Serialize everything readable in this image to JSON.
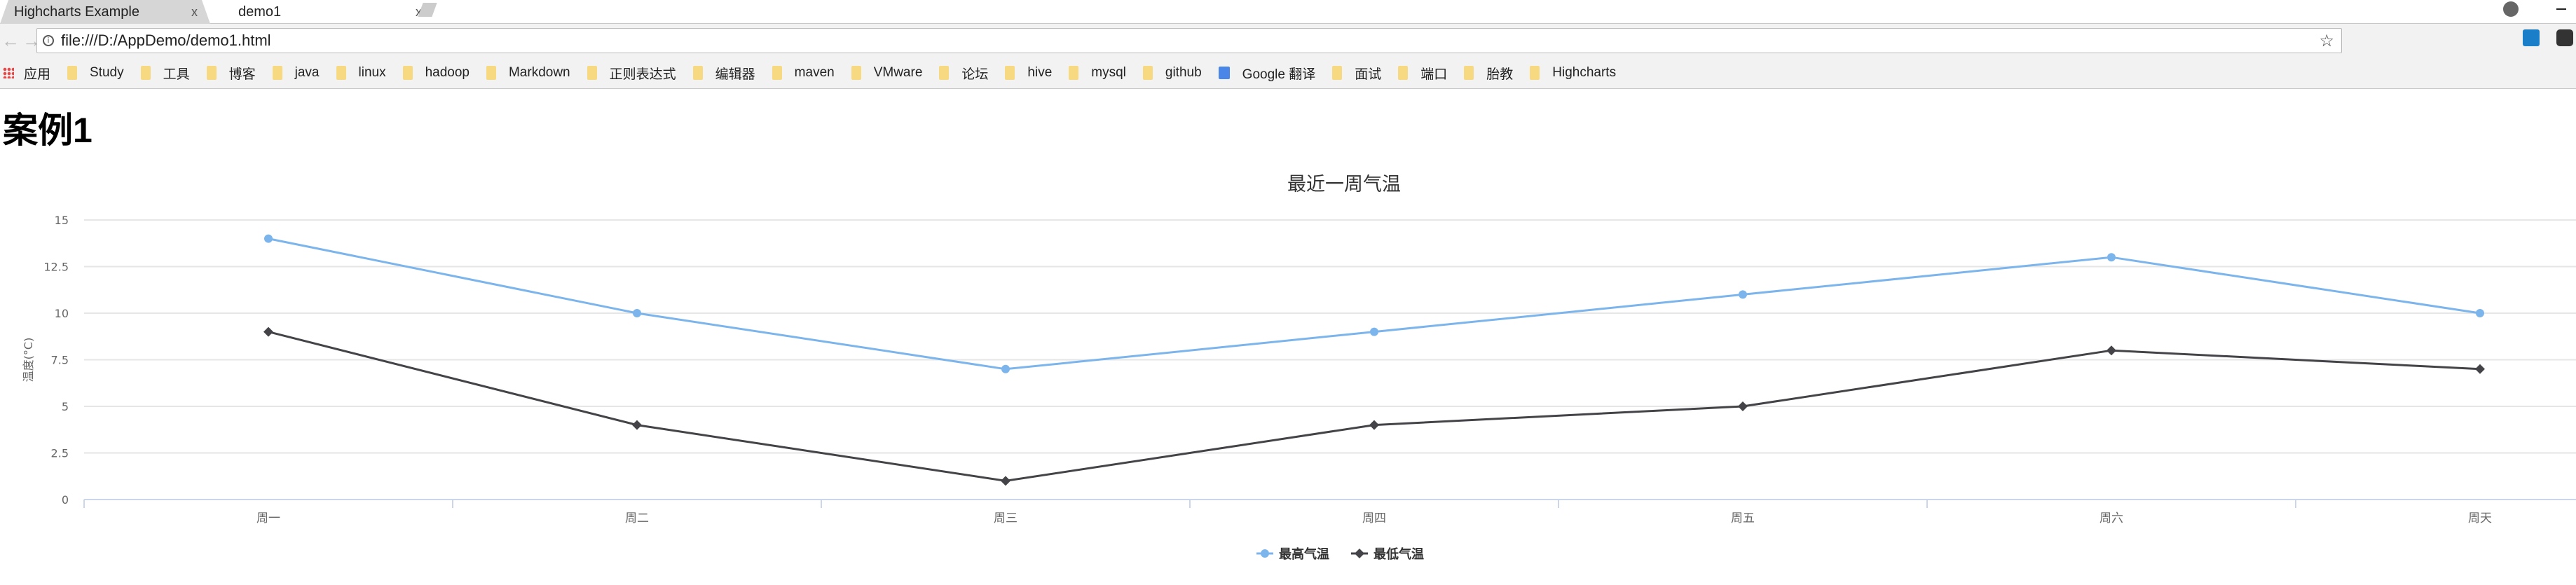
{
  "browser": {
    "tabs": [
      {
        "label": "Highcharts Example",
        "active": false
      },
      {
        "label": "demo1",
        "active": true
      }
    ],
    "url": "file:///D:/AppDemo/demo1.html",
    "bookmarks": [
      {
        "label": "应用",
        "icon": "apps-icon"
      },
      {
        "label": "Study",
        "icon": "folder-icon"
      },
      {
        "label": "工具",
        "icon": "folder-icon"
      },
      {
        "label": "博客",
        "icon": "folder-icon"
      },
      {
        "label": "java",
        "icon": "folder-icon"
      },
      {
        "label": "linux",
        "icon": "folder-icon"
      },
      {
        "label": "hadoop",
        "icon": "folder-icon"
      },
      {
        "label": "Markdown",
        "icon": "folder-icon"
      },
      {
        "label": "正则表达式",
        "icon": "folder-icon"
      },
      {
        "label": "编辑器",
        "icon": "folder-icon"
      },
      {
        "label": "maven",
        "icon": "folder-icon"
      },
      {
        "label": "VMware",
        "icon": "folder-icon"
      },
      {
        "label": "论坛",
        "icon": "folder-icon"
      },
      {
        "label": "hive",
        "icon": "folder-icon"
      },
      {
        "label": "mysql",
        "icon": "folder-icon"
      },
      {
        "label": "github",
        "icon": "folder-icon"
      },
      {
        "label": "Google 翻译",
        "icon": "google-translate-icon"
      },
      {
        "label": "面试",
        "icon": "folder-icon"
      },
      {
        "label": "端口",
        "icon": "folder-icon"
      },
      {
        "label": "胎教",
        "icon": "folder-icon"
      },
      {
        "label": "Highcharts",
        "icon": "folder-icon"
      }
    ]
  },
  "page": {
    "heading": "案例1"
  },
  "chart_data": {
    "type": "line",
    "title": "最近一周气温",
    "ylabel": "温度(°C)",
    "ylim": [
      0,
      15
    ],
    "yticks": [
      "0",
      "2.5",
      "5",
      "7.5",
      "10",
      "12.5",
      "15"
    ],
    "categories": [
      "周一",
      "周二",
      "周三",
      "周四",
      "周五",
      "周六",
      "周天"
    ],
    "grid": true,
    "legend": "bottom-center",
    "series": [
      {
        "name": "最高气温",
        "values": [
          14,
          10,
          7,
          9,
          11,
          13,
          10
        ],
        "color": "#7cb5ec",
        "marker": "circle"
      },
      {
        "name": "最低气温",
        "values": [
          9,
          4,
          1,
          4,
          5,
          8,
          7
        ],
        "color": "#434348",
        "marker": "diamond"
      }
    ]
  }
}
